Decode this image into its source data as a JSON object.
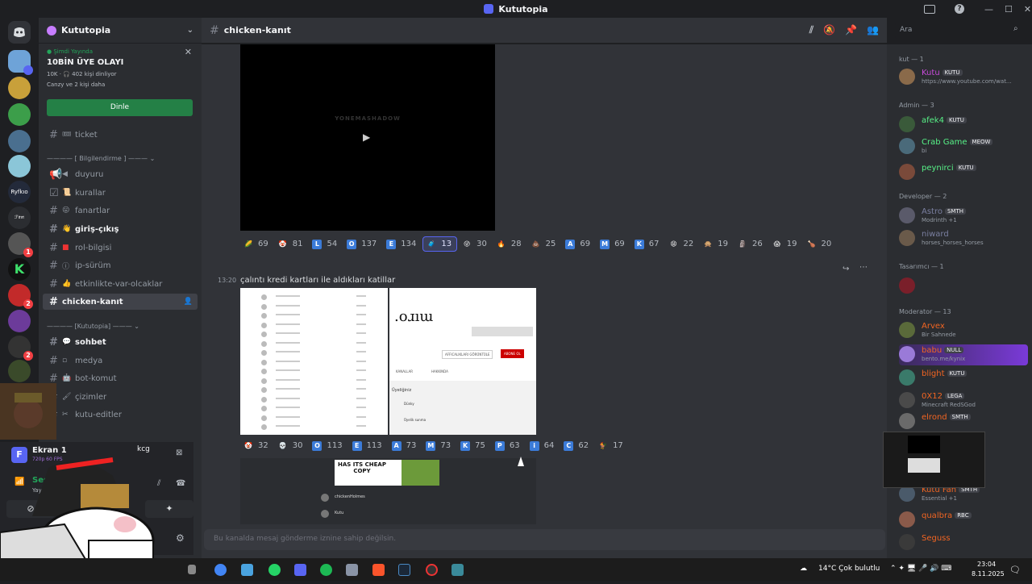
{
  "window": {
    "title": "Kututopia"
  },
  "server": {
    "name": "Kututopia"
  },
  "event": {
    "live_label": "Şimdi Yayında",
    "title": "10BİN ÜYE OLAYI",
    "meta1": "10K · 🎧 402 kişi dinliyor",
    "meta2": "Canzy ve 2 kişi daha",
    "listen_label": "Dinle"
  },
  "channels": [
    {
      "label": "ticket"
    },
    {
      "label": "duyuru"
    },
    {
      "label": "kurallar"
    },
    {
      "label": "fanartlar"
    },
    {
      "label": "giriş-çıkış"
    },
    {
      "label": "rol-bilgisi"
    },
    {
      "label": "ip-sürüm"
    },
    {
      "label": "etkinlikte-var-olcaklar"
    },
    {
      "label": "chicken-kanıt"
    },
    {
      "label": "sohbet"
    },
    {
      "label": "medya"
    },
    {
      "label": "bot-komut"
    },
    {
      "label": "çizimler"
    },
    {
      "label": "kutu-editler"
    }
  ],
  "categories": {
    "bilgi": "[ Bilgilendirme ]",
    "kutu": "[Kututopia]"
  },
  "userpanel": {
    "screen_title": "Ekran 1",
    "screen_sub": "720p 60 FPS",
    "user_tag": "kcg",
    "voice_title": "Ses Bağlantı",
    "voice_sub": "Yayınözel / C"
  },
  "topbar": {
    "channel": "chicken-kanıt",
    "search_placeholder": "Ara"
  },
  "chat": {
    "video_watermark": "YONEMASHADOW",
    "reactions1": [
      {
        "e": "🌽",
        "n": "69",
        "c": "#0000"
      },
      {
        "e": "🤡",
        "n": "81",
        "c": "#0000"
      },
      {
        "e": "L",
        "n": "54",
        "c": "#3b7bd8"
      },
      {
        "e": "O",
        "n": "137",
        "c": "#3b7bd8"
      },
      {
        "e": "E",
        "n": "134",
        "c": "#3b7bd8"
      },
      {
        "e": "🧳",
        "n": "13",
        "c": "#0000",
        "sel": true
      },
      {
        "e": "😜",
        "n": "30",
        "c": "#0000"
      },
      {
        "e": "🔥",
        "n": "28",
        "c": "#0000"
      },
      {
        "e": "💩",
        "n": "25",
        "c": "#0000"
      },
      {
        "e": "A",
        "n": "69",
        "c": "#3b7bd8"
      },
      {
        "e": "M",
        "n": "69",
        "c": "#3b7bd8"
      },
      {
        "e": "K",
        "n": "67",
        "c": "#3b7bd8"
      },
      {
        "e": "😫",
        "n": "22",
        "c": "#0000"
      },
      {
        "e": "🙊",
        "n": "19",
        "c": "#0000"
      },
      {
        "e": "🗿",
        "n": "26",
        "c": "#0000"
      },
      {
        "e": "😱",
        "n": "19",
        "c": "#0000"
      },
      {
        "e": "🍗",
        "n": "20",
        "c": "#0000"
      }
    ],
    "msg_time": "13:20",
    "msg_text": "çalıntı kredi kartları ile aldıkları katillar",
    "img2_text": ".oɹıɯ",
    "img2_btn1": "AFFICALIKLARI GÖRÜNTÜLE",
    "img2_btn2": "ABONE OL",
    "img2_tab1": "KANALLAR",
    "img2_tab2": "HAKKINDA",
    "img2_section": "Üyeliğiniz",
    "img2_item1": "Dünky",
    "img2_item2": "Üyelik sunma",
    "reactions2": [
      {
        "e": "🤡",
        "n": "32",
        "c": "#0000"
      },
      {
        "e": "💀",
        "n": "30",
        "c": "#0000"
      },
      {
        "e": "O",
        "n": "113",
        "c": "#3b7bd8"
      },
      {
        "e": "E",
        "n": "113",
        "c": "#3b7bd8"
      },
      {
        "e": "A",
        "n": "73",
        "c": "#3b7bd8"
      },
      {
        "e": "M",
        "n": "73",
        "c": "#3b7bd8"
      },
      {
        "e": "K",
        "n": "75",
        "c": "#3b7bd8"
      },
      {
        "e": "P",
        "n": "63",
        "c": "#3b7bd8"
      },
      {
        "e": "i",
        "n": "64",
        "c": "#3b7bd8"
      },
      {
        "e": "C",
        "n": "62",
        "c": "#3b7bd8"
      },
      {
        "e": "🐓",
        "n": "17",
        "c": "#0000"
      }
    ],
    "img3_text": "HAS ITS CHEAP COPY",
    "img3_user1": "chickenHolmes",
    "img3_user2": "Kutu",
    "composer_placeholder": "Bu kanalda mesaj gönderme iznine sahip değilsin."
  },
  "members": {
    "groups": [
      {
        "label": "kut — 1"
      },
      {
        "label": "Admin — 3"
      },
      {
        "label": "Developer — 2"
      },
      {
        "label": "Tasarımcı — 1"
      },
      {
        "label": "Moderator — 13"
      }
    ],
    "list": [
      {
        "name": "Kutu",
        "tag": "KUTU",
        "status": "https://www.youtube.com/wat...",
        "color": "#c74bd9"
      },
      {
        "name": "afek4",
        "tag": "KUTU",
        "status": "",
        "color": "#57f287"
      },
      {
        "name": "Crab Game",
        "tag": "MEOW",
        "status": "bi",
        "color": "#57f287"
      },
      {
        "name": "peynirci",
        "tag": "KUTU",
        "status": "",
        "color": "#57f287"
      },
      {
        "name": "Astro",
        "tag": "SMTH",
        "status": "Modrinth +1",
        "color": "#7a7fa0"
      },
      {
        "name": "niward",
        "tag": "",
        "status": "horses_horses_horses",
        "color": "#7a7fa0"
      },
      {
        "name": "",
        "tag": "",
        "status": "",
        "color": "#7a1f2a"
      },
      {
        "name": "Arvex",
        "tag": "",
        "status": "Bir Sahnede",
        "color": "#f26522"
      },
      {
        "name": "babu",
        "tag": "NULL",
        "status": "bento.me/kynix",
        "color": "#f26522"
      },
      {
        "name": "blight",
        "tag": "KUTU",
        "status": "",
        "color": "#f26522"
      },
      {
        "name": "0X12",
        "tag": "LEGA",
        "status": "Minecraft RedSGod",
        "color": "#f26522"
      },
      {
        "name": "elrond",
        "tag": "SMTH",
        "status": "",
        "color": "#f26522"
      },
      {
        "name": "Kutu Fan",
        "tag": "SMTH",
        "status": "Essential +1",
        "color": "#f26522"
      },
      {
        "name": "qualbra",
        "tag": "RBC",
        "status": "",
        "color": "#f26522"
      },
      {
        "name": "Seguss",
        "tag": "",
        "status": "",
        "color": "#f26522"
      }
    ]
  },
  "taskbar": {
    "weather": "14°C  Çok bulutlu",
    "time": "23:04",
    "date": "8.11.2025"
  },
  "colors": {
    "accent": "#5865f2",
    "green": "#248046",
    "bg": "#313338"
  }
}
